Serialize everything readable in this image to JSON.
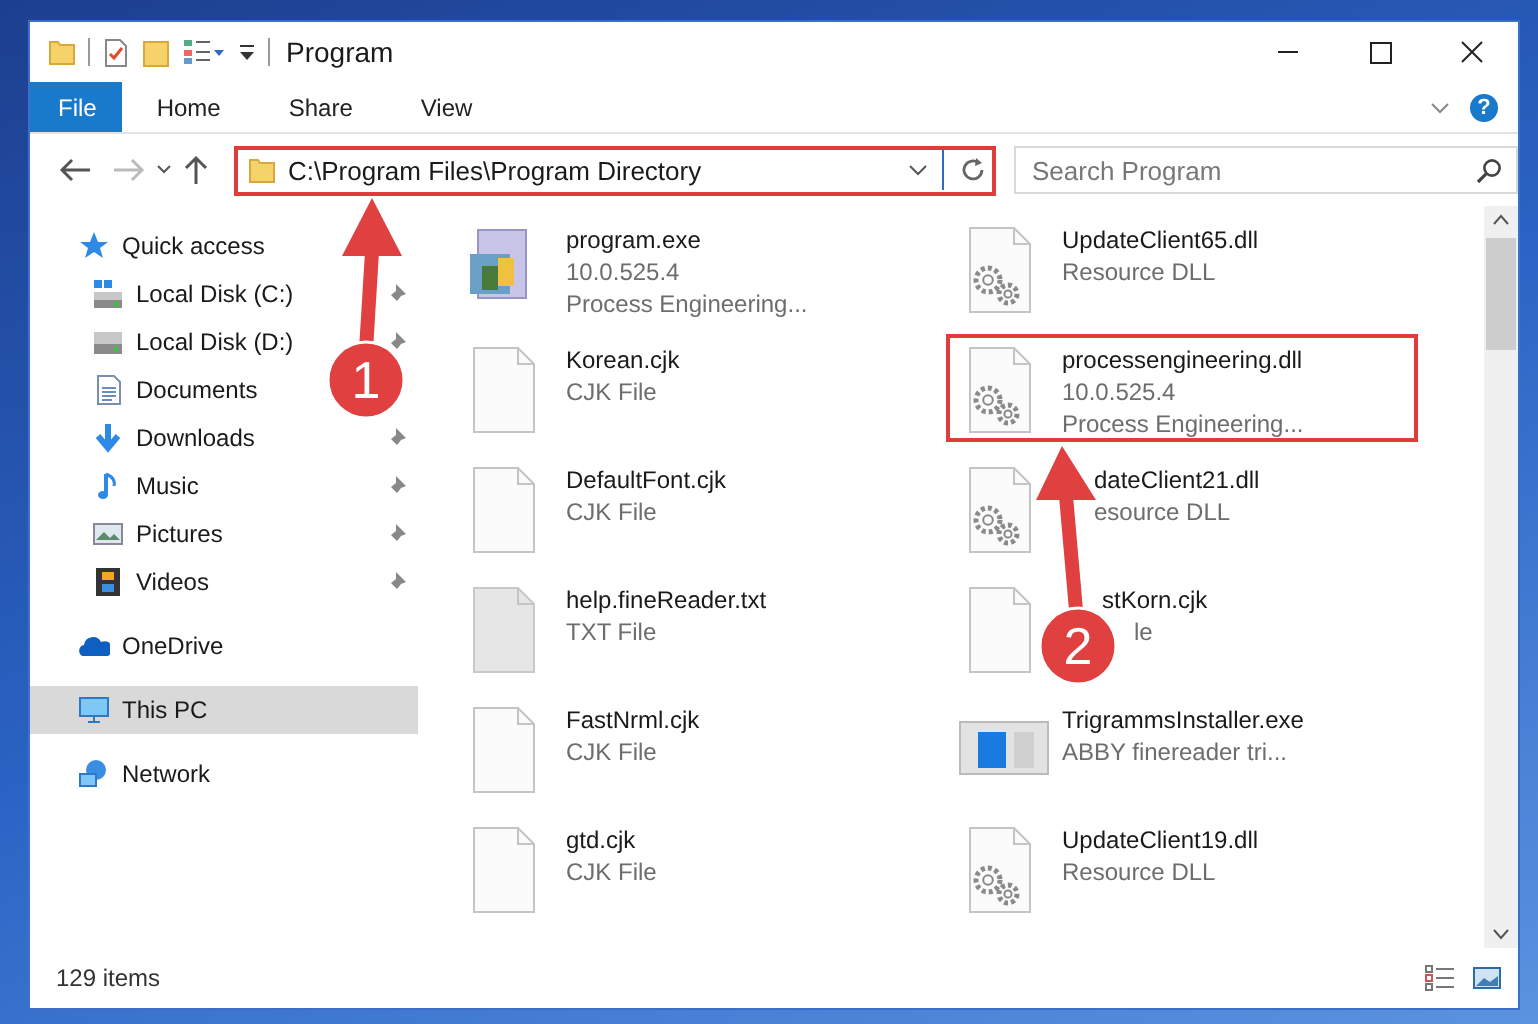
{
  "window": {
    "title": "Program"
  },
  "ribbon_tabs": [
    {
      "label": "File",
      "selected": true
    },
    {
      "label": "Home",
      "selected": false
    },
    {
      "label": "Share",
      "selected": false
    },
    {
      "label": "View",
      "selected": false
    }
  ],
  "help_button": "?",
  "address_bar": {
    "path": "C:\\Program Files\\Program Directory",
    "highlighted": true
  },
  "search": {
    "placeholder": "Search Program"
  },
  "sidebar": {
    "items": [
      {
        "label": "Quick access",
        "kind": "star",
        "selected": false,
        "children": [
          {
            "label": "Local Disk (C:)",
            "kind": "drive-c",
            "pinned": true,
            "selected": false
          },
          {
            "label": "Local Disk (D:)",
            "kind": "drive",
            "pinned": true,
            "selected": false
          },
          {
            "label": "Documents",
            "kind": "documents",
            "pinned": false,
            "selected": false
          },
          {
            "label": "Downloads",
            "kind": "downloads",
            "pinned": true,
            "selected": false
          },
          {
            "label": "Music",
            "kind": "music",
            "pinned": true,
            "selected": false
          },
          {
            "label": "Pictures",
            "kind": "pictures",
            "pinned": true,
            "selected": false
          },
          {
            "label": "Videos",
            "kind": "videos",
            "pinned": true,
            "selected": false
          }
        ]
      },
      {
        "label": "OneDrive",
        "kind": "cloud",
        "selected": false
      },
      {
        "label": "This PC",
        "kind": "pc",
        "selected": true
      },
      {
        "label": "Network",
        "kind": "network",
        "selected": false
      }
    ]
  },
  "files": [
    {
      "name": "program.exe",
      "details": [
        "10.0.525.4",
        "Process Engineering..."
      ],
      "kind": "app",
      "highlighted": false
    },
    {
      "name": "Korean.cjk",
      "details": [
        "CJK File"
      ],
      "kind": "blank",
      "highlighted": false
    },
    {
      "name": "DefaultFont.cjk",
      "details": [
        "CJK File"
      ],
      "kind": "blank",
      "highlighted": false
    },
    {
      "name": "help.fineReader.txt",
      "details": [
        "TXT File"
      ],
      "kind": "text",
      "highlighted": false
    },
    {
      "name": "FastNrml.cjk",
      "details": [
        "CJK File"
      ],
      "kind": "blank",
      "highlighted": false
    },
    {
      "name": "gtd.cjk",
      "details": [
        "CJK File"
      ],
      "kind": "blank",
      "highlighted": false
    },
    {
      "name": "UpdateClient65.dll",
      "details": [
        "Resource DLL"
      ],
      "kind": "gear",
      "highlighted": false
    },
    {
      "name": "processengineering.dll",
      "details": [
        "10.0.525.4",
        "Process Engineering..."
      ],
      "kind": "gear",
      "highlighted": true
    },
    {
      "name": "dateClient21.dll",
      "details": [
        "esource DLL"
      ],
      "kind": "gear",
      "behind_arrow": true,
      "highlighted": false
    },
    {
      "name": "stKorn.cjk",
      "details": [
        "le"
      ],
      "kind": "blank",
      "behind_badge": true,
      "highlighted": false
    },
    {
      "name": "TrigrammsInstaller.exe",
      "details": [
        "ABBY finereader tri..."
      ],
      "kind": "installer",
      "highlighted": false
    },
    {
      "name": "UpdateClient19.dll",
      "details": [
        "Resource DLL"
      ],
      "kind": "gear",
      "highlighted": false
    }
  ],
  "status_bar": {
    "item_count": "129 items"
  },
  "callouts": [
    {
      "number": "1"
    },
    {
      "number": "2"
    }
  ]
}
